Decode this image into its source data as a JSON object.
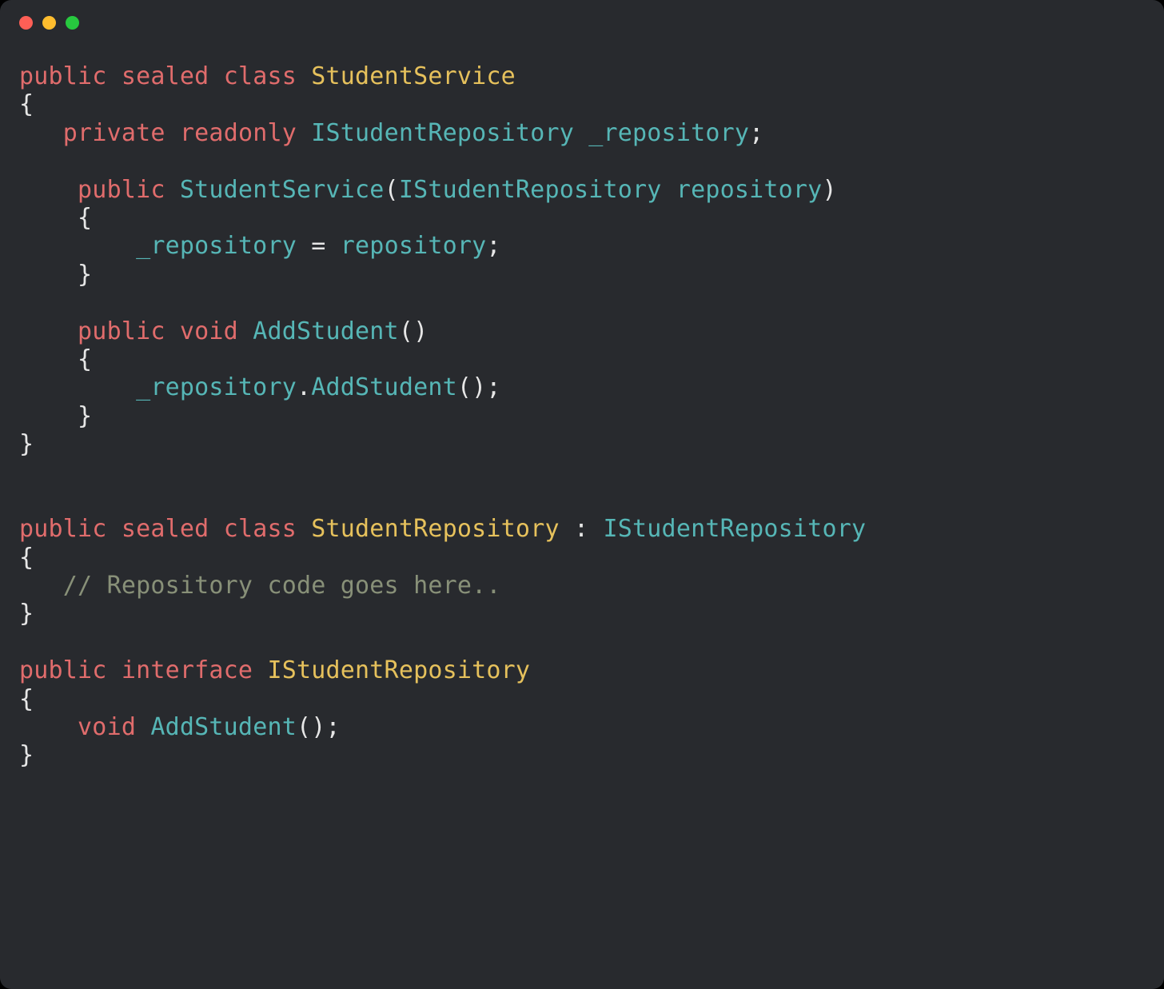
{
  "window": {
    "dots": [
      "red",
      "yellow",
      "green"
    ]
  },
  "code": {
    "language": "csharp",
    "tokens": [
      [
        {
          "t": "public",
          "c": "kw-salmon"
        },
        {
          "t": " "
        },
        {
          "t": "sealed",
          "c": "kw-salmon"
        },
        {
          "t": " "
        },
        {
          "t": "class",
          "c": "kw-salmon"
        },
        {
          "t": " "
        },
        {
          "t": "StudentService",
          "c": "type-yel"
        }
      ],
      [
        {
          "t": "{",
          "c": "punct"
        }
      ],
      [
        {
          "t": "   "
        },
        {
          "t": "private",
          "c": "kw-salmon"
        },
        {
          "t": " "
        },
        {
          "t": "readonly",
          "c": "kw-salmon"
        },
        {
          "t": " "
        },
        {
          "t": "IStudentRepository",
          "c": "type-teal"
        },
        {
          "t": " "
        },
        {
          "t": "_repository",
          "c": "ident"
        },
        {
          "t": ";",
          "c": "punct"
        }
      ],
      [
        {
          "t": ""
        }
      ],
      [
        {
          "t": "    "
        },
        {
          "t": "public",
          "c": "kw-salmon"
        },
        {
          "t": " "
        },
        {
          "t": "StudentService",
          "c": "type-teal"
        },
        {
          "t": "(",
          "c": "paren"
        },
        {
          "t": "IStudentRepository",
          "c": "type-teal"
        },
        {
          "t": " "
        },
        {
          "t": "repository",
          "c": "ident"
        },
        {
          "t": ")",
          "c": "paren"
        }
      ],
      [
        {
          "t": "    "
        },
        {
          "t": "{",
          "c": "punct"
        }
      ],
      [
        {
          "t": "        "
        },
        {
          "t": "_repository",
          "c": "ident"
        },
        {
          "t": " = ",
          "c": "plain"
        },
        {
          "t": "repository",
          "c": "ident"
        },
        {
          "t": ";",
          "c": "punct"
        }
      ],
      [
        {
          "t": "    "
        },
        {
          "t": "}",
          "c": "punct"
        }
      ],
      [
        {
          "t": ""
        }
      ],
      [
        {
          "t": "    "
        },
        {
          "t": "public",
          "c": "kw-salmon"
        },
        {
          "t": " "
        },
        {
          "t": "void",
          "c": "kw-void"
        },
        {
          "t": " "
        },
        {
          "t": "AddStudent",
          "c": "memb-cyan"
        },
        {
          "t": "()",
          "c": "paren"
        }
      ],
      [
        {
          "t": "    "
        },
        {
          "t": "{",
          "c": "punct"
        }
      ],
      [
        {
          "t": "        "
        },
        {
          "t": "_repository",
          "c": "ident"
        },
        {
          "t": ".",
          "c": "punct"
        },
        {
          "t": "AddStudent",
          "c": "memb-cyan"
        },
        {
          "t": "();",
          "c": "paren"
        }
      ],
      [
        {
          "t": "    "
        },
        {
          "t": "}",
          "c": "punct"
        }
      ],
      [
        {
          "t": "}",
          "c": "punct"
        }
      ],
      [
        {
          "t": ""
        }
      ],
      [
        {
          "t": ""
        }
      ],
      [
        {
          "t": "public",
          "c": "kw-salmon"
        },
        {
          "t": " "
        },
        {
          "t": "sealed",
          "c": "kw-salmon"
        },
        {
          "t": " "
        },
        {
          "t": "class",
          "c": "kw-salmon"
        },
        {
          "t": " "
        },
        {
          "t": "StudentRepository",
          "c": "type-yel"
        },
        {
          "t": " : ",
          "c": "plain"
        },
        {
          "t": "IStudentRepository",
          "c": "type-teal"
        }
      ],
      [
        {
          "t": "{",
          "c": "punct"
        }
      ],
      [
        {
          "t": "   "
        },
        {
          "t": "// Repository code goes here..",
          "c": "comment"
        }
      ],
      [
        {
          "t": "}",
          "c": "punct"
        }
      ],
      [
        {
          "t": ""
        }
      ],
      [
        {
          "t": "public",
          "c": "kw-salmon"
        },
        {
          "t": " "
        },
        {
          "t": "interface",
          "c": "kw-salmon"
        },
        {
          "t": " "
        },
        {
          "t": "IStudentRepository",
          "c": "type-yel"
        }
      ],
      [
        {
          "t": "{",
          "c": "punct"
        }
      ],
      [
        {
          "t": "    "
        },
        {
          "t": "void",
          "c": "kw-void"
        },
        {
          "t": " "
        },
        {
          "t": "AddStudent",
          "c": "memb-cyan"
        },
        {
          "t": "();",
          "c": "paren"
        }
      ],
      [
        {
          "t": "}",
          "c": "punct"
        }
      ]
    ]
  }
}
